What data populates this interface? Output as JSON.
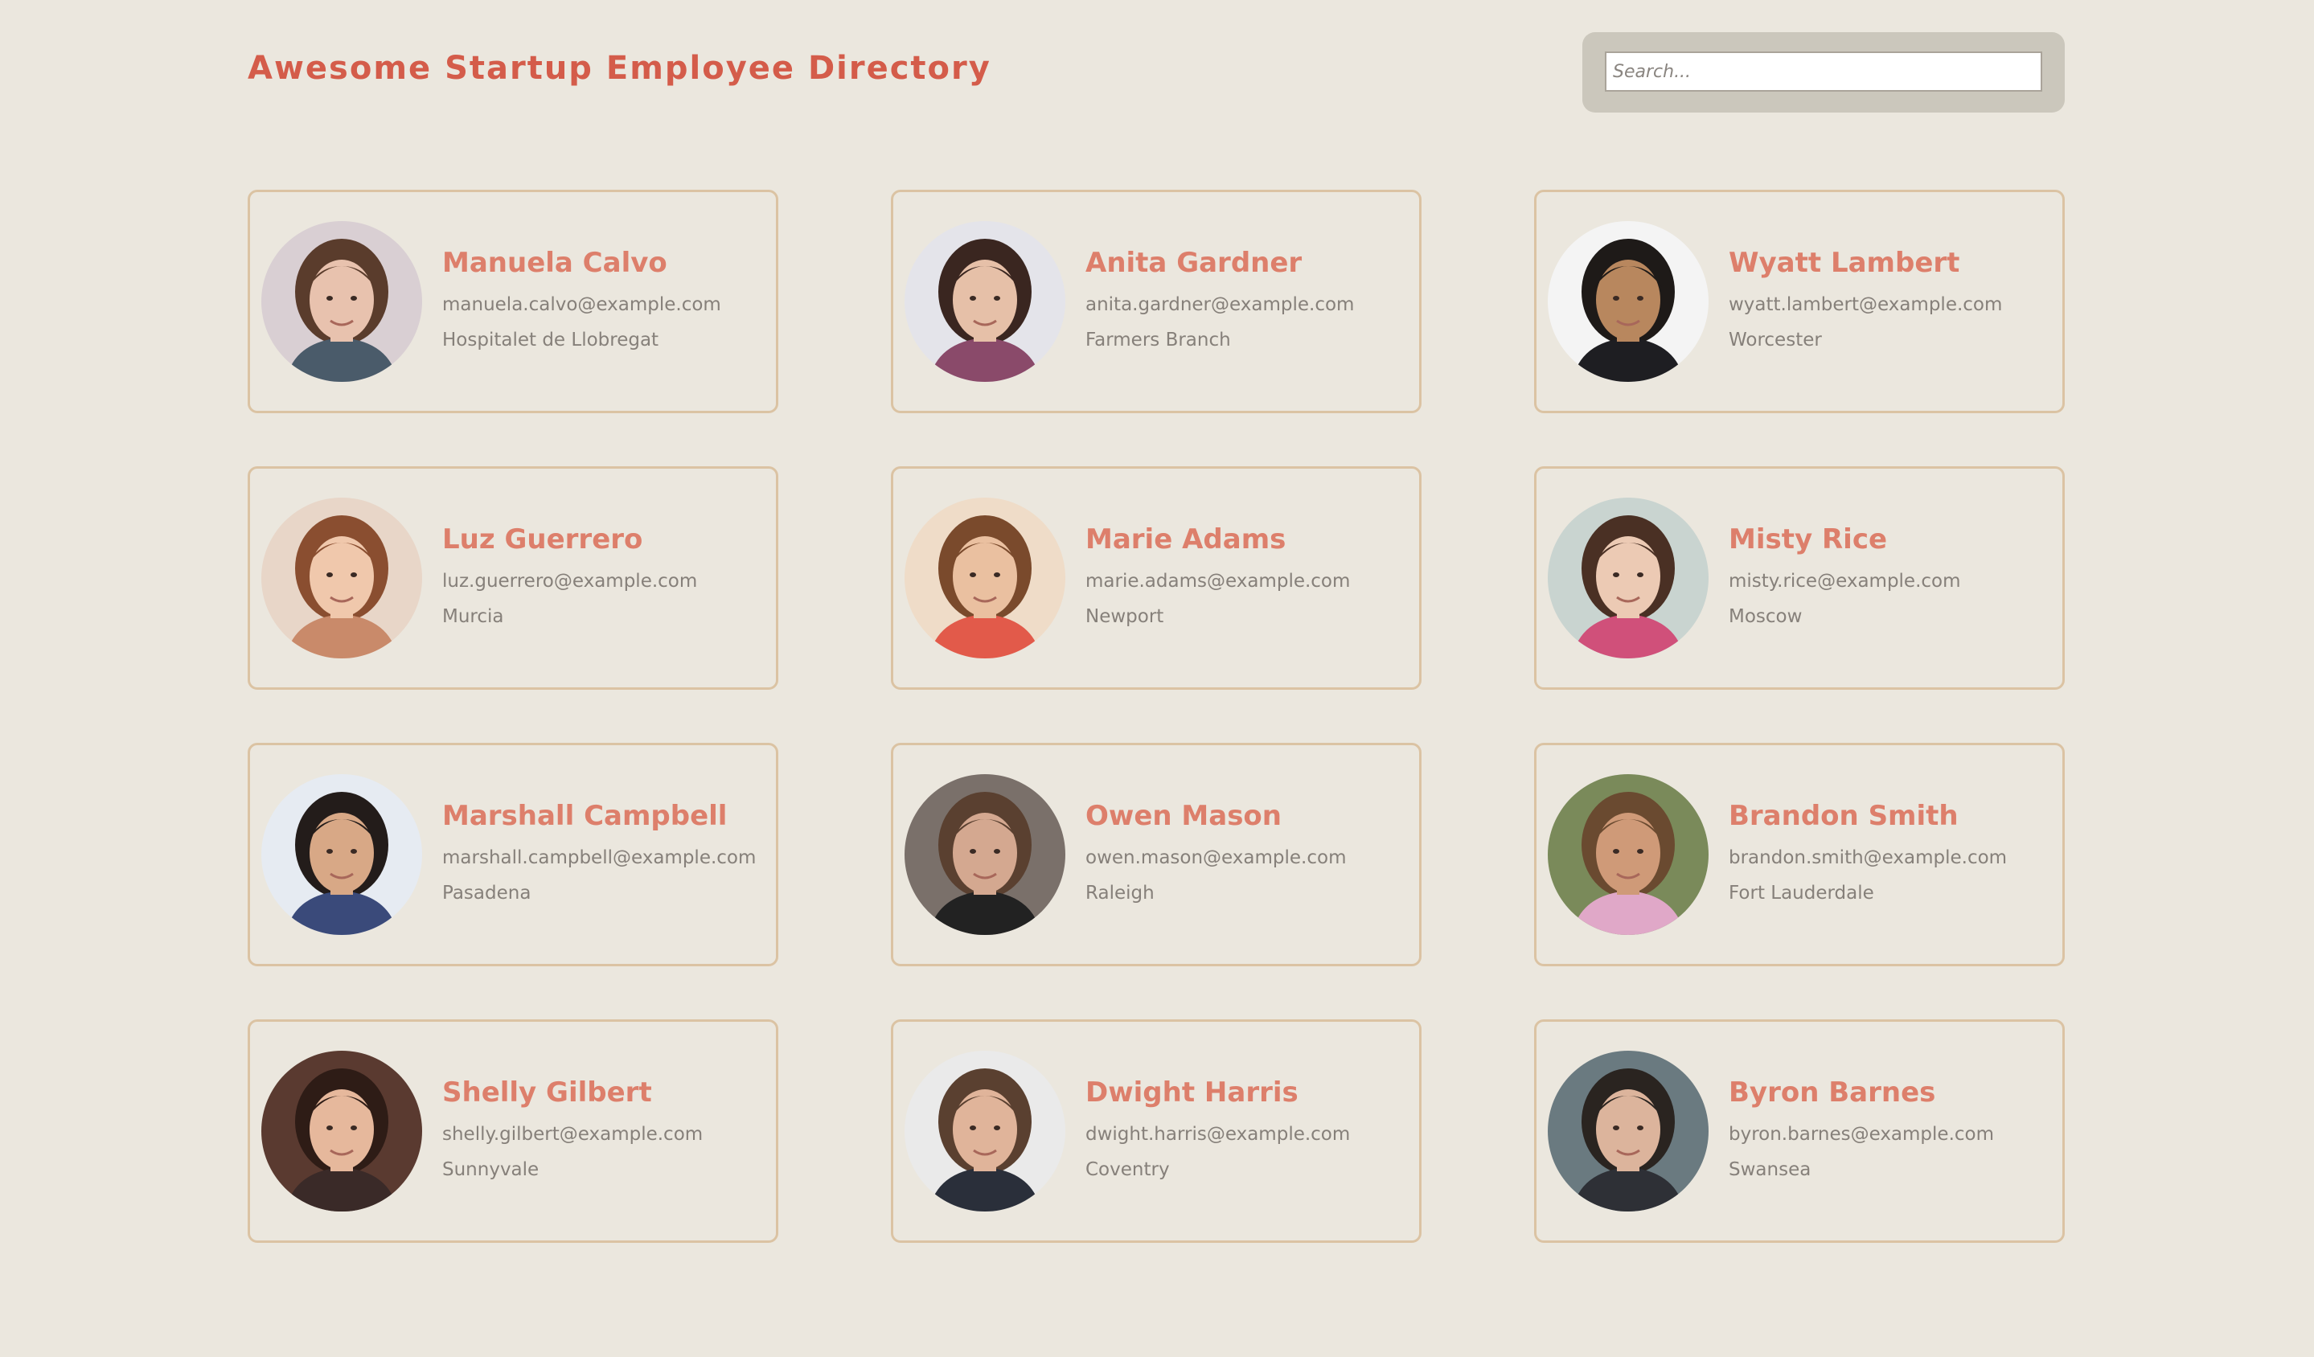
{
  "header": {
    "title": "Awesome Startup Employee Directory",
    "search_placeholder": "Search..."
  },
  "employees": [
    {
      "name": "Manuela Calvo",
      "email": "manuela.calvo@example.com",
      "city": "Hospitalet de Llobregat",
      "photo": {
        "bg": "#d9cfd3",
        "hair": "#5a3c2c",
        "skin": "#e8c2ae",
        "shirt": "#4a5b6a"
      }
    },
    {
      "name": "Anita Gardner",
      "email": "anita.gardner@example.com",
      "city": "Farmers Branch",
      "photo": {
        "bg": "#e4e4ea",
        "hair": "#3a2620",
        "skin": "#e6c0a8",
        "shirt": "#8a4a6a"
      }
    },
    {
      "name": "Wyatt Lambert",
      "email": "wyatt.lambert@example.com",
      "city": "Worcester",
      "photo": {
        "bg": "#f4f4f4",
        "hair": "#1e1a18",
        "skin": "#b8875e",
        "shirt": "#1e1e22"
      }
    },
    {
      "name": "Luz Guerrero",
      "email": "luz.guerrero@example.com",
      "city": "Murcia",
      "photo": {
        "bg": "#e8d6c8",
        "hair": "#8a4e30",
        "skin": "#f0c8ac",
        "shirt": "#c98a6a"
      }
    },
    {
      "name": "Marie Adams",
      "email": "marie.adams@example.com",
      "city": "Newport",
      "photo": {
        "bg": "#efdcc8",
        "hair": "#7a4a2c",
        "skin": "#eac0a0",
        "shirt": "#e25a4a"
      }
    },
    {
      "name": "Misty Rice",
      "email": "misty.rice@example.com",
      "city": "Moscow",
      "photo": {
        "bg": "#c9d4d0",
        "hair": "#4a3024",
        "skin": "#eccab4",
        "shirt": "#d0507a"
      }
    },
    {
      "name": "Marshall Campbell",
      "email": "marshall.campbell@example.com",
      "city": "Pasadena",
      "photo": {
        "bg": "#e6ebf2",
        "hair": "#231c1a",
        "skin": "#d8a886",
        "shirt": "#3a4a7a"
      }
    },
    {
      "name": "Owen Mason",
      "email": "owen.mason@example.com",
      "city": "Raleigh",
      "photo": {
        "bg": "#7a706a",
        "hair": "#5a4030",
        "skin": "#d4a890",
        "shirt": "#222222"
      }
    },
    {
      "name": "Brandon Smith",
      "email": "brandon.smith@example.com",
      "city": "Fort Lauderdale",
      "photo": {
        "bg": "#7a8a5a",
        "hair": "#6a4a30",
        "skin": "#cf9a78",
        "shirt": "#e0a8c8"
      }
    },
    {
      "name": "Shelly Gilbert",
      "email": "shelly.gilbert@example.com",
      "city": "Sunnyvale",
      "photo": {
        "bg": "#5a3a30",
        "hair": "#2e1c16",
        "skin": "#e6b89c",
        "shirt": "#3a2a28"
      }
    },
    {
      "name": "Dwight Harris",
      "email": "dwight.harris@example.com",
      "city": "Coventry",
      "photo": {
        "bg": "#eaeaea",
        "hair": "#5a4030",
        "skin": "#e0b49a",
        "shirt": "#2a2f3a"
      }
    },
    {
      "name": "Byron Barnes",
      "email": "byron.barnes@example.com",
      "city": "Swansea",
      "photo": {
        "bg": "#6a7a80",
        "hair": "#2a2420",
        "skin": "#dcb49c",
        "shirt": "#2e3036"
      }
    }
  ]
}
